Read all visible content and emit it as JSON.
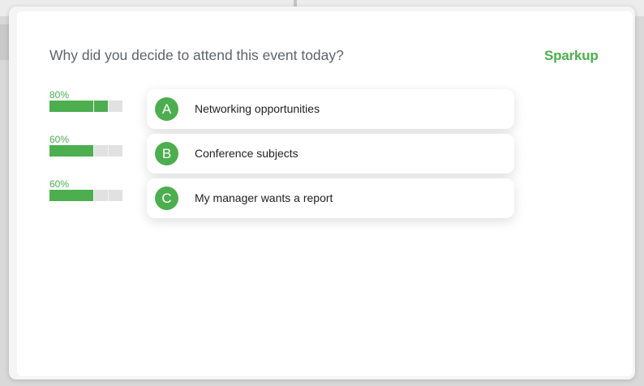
{
  "poll": {
    "question": "Why did you decide to attend this event today?",
    "brand": "Sparkup",
    "accent_color": "#4cae4f",
    "results": [
      {
        "percent_label": "80%",
        "fraction": 0.8
      },
      {
        "percent_label": "60%",
        "fraction": 0.6
      },
      {
        "percent_label": "60%",
        "fraction": 0.6
      }
    ],
    "options": [
      {
        "letter": "A",
        "text": "Networking opportunities"
      },
      {
        "letter": "B",
        "text": "Conference subjects"
      },
      {
        "letter": "C",
        "text": "My manager wants a report"
      }
    ]
  }
}
